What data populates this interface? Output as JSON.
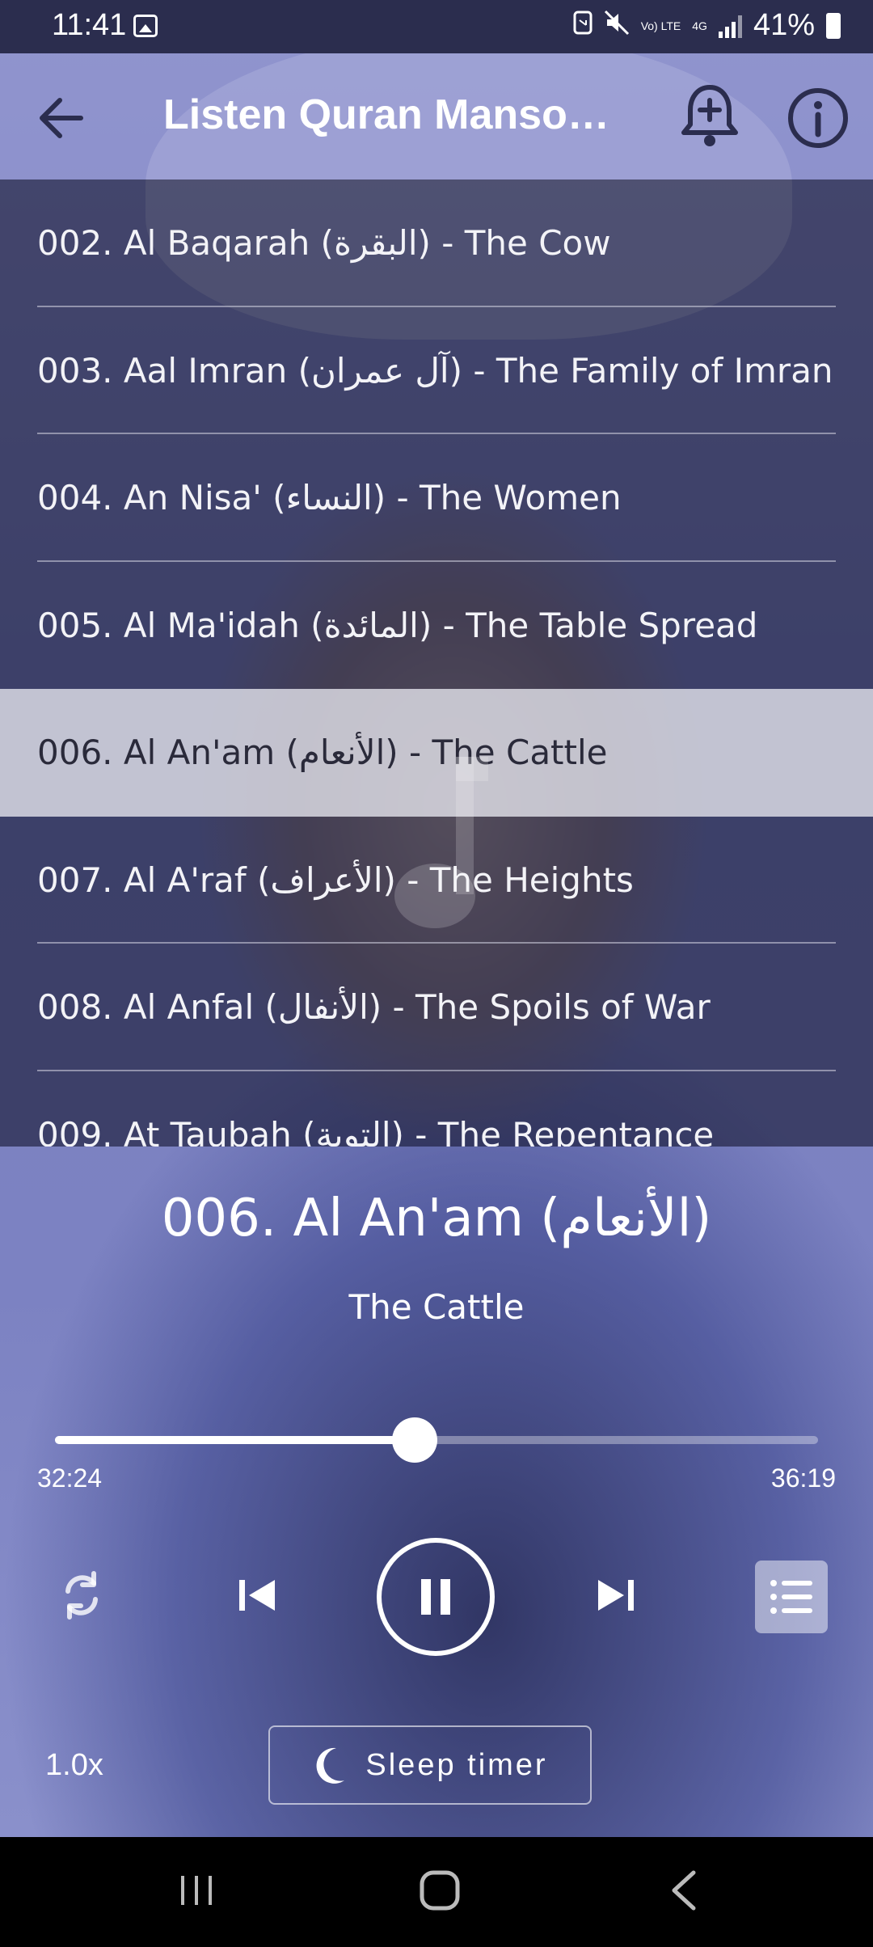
{
  "status_bar": {
    "time": "11:41",
    "battery": "41%",
    "network": "4G",
    "volte": "Vo) LTE"
  },
  "app_bar": {
    "title": "Listen Quran Manso…",
    "icons": [
      "back-arrow-icon",
      "bell-add-icon",
      "info-icon"
    ]
  },
  "playlist": {
    "items": [
      {
        "label": "002. Al Baqarah (البقرة) - The Cow",
        "selected": false
      },
      {
        "label": "003. Aal Imran (آل عمران) - The Family of Imran",
        "selected": false
      },
      {
        "label": "004. An Nisa' (النساء) - The Women",
        "selected": false
      },
      {
        "label": "005. Al Ma'idah (المائدة) - The Table Spread",
        "selected": false
      },
      {
        "label": "006. Al An'am (الأنعام) - The Cattle",
        "selected": true
      },
      {
        "label": "007. Al A'raf (الأعراف) - The Heights",
        "selected": false
      },
      {
        "label": "008. Al Anfal (الأنفال) - The Spoils of War",
        "selected": false
      },
      {
        "label": "009. At Taubah (التوبة) - The Repentance",
        "selected": false
      }
    ]
  },
  "player": {
    "title": "006. Al An'am (الأنعام)",
    "subtitle": "The Cattle",
    "elapsed": "32:24",
    "total": "36:19",
    "progress": 0.471,
    "speed": "1.0x",
    "sleep_timer_label": "Sleep timer"
  },
  "colors": {
    "accent": "#ffffff",
    "overlay": "#2b2d4e",
    "background": "#7d83c0",
    "selected_row": "#e8e8f0"
  }
}
